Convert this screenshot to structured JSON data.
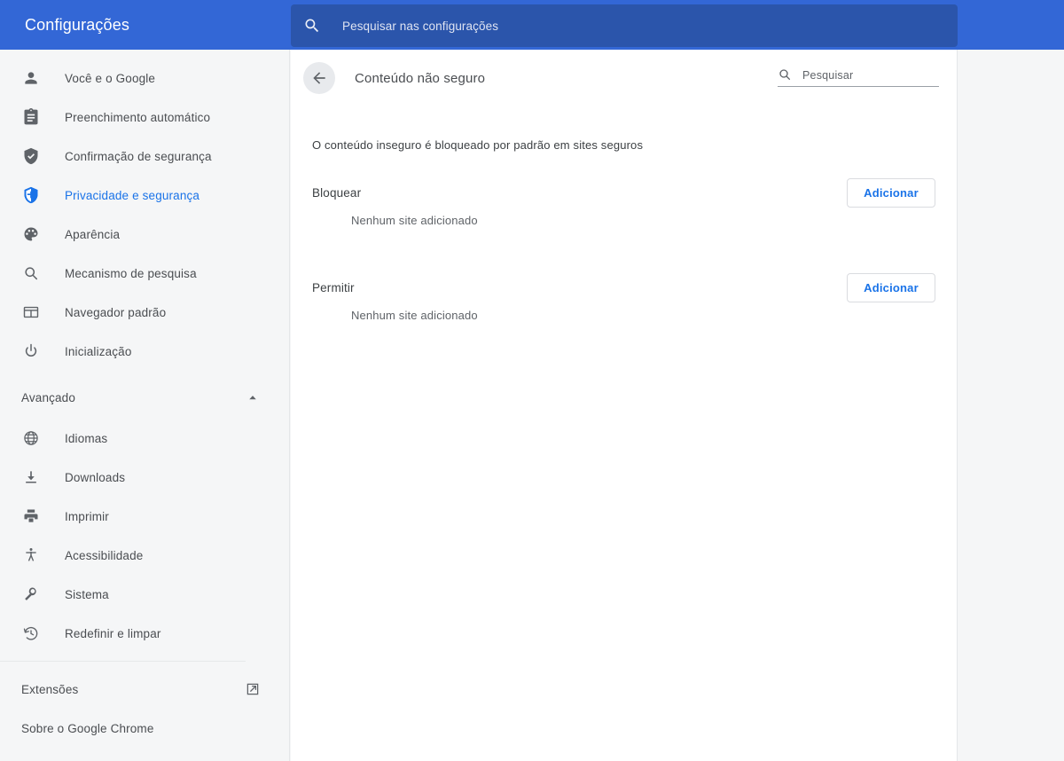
{
  "colors": {
    "header_blue": "#3367d6",
    "search_blue": "#2b55ab",
    "accent_blue": "#1a73e8",
    "sidebar_bg": "#f5f6f7",
    "card_bg": "#ffffff",
    "text_primary": "#3c4043",
    "text_secondary": "#5f6368",
    "divider": "#e4e6e9"
  },
  "topbar": {
    "title": "Configurações",
    "search_icon": "search-icon",
    "search_placeholder": "Pesquisar nas configurações",
    "search_value": ""
  },
  "sidebar": {
    "items": [
      {
        "label": "Você e o Google",
        "icon": "person-icon",
        "selected": false
      },
      {
        "label": "Preenchimento automático",
        "icon": "clipboard-icon",
        "selected": false
      },
      {
        "label": "Confirmação de segurança",
        "icon": "shield-check-icon",
        "selected": false
      },
      {
        "label": "Privacidade e segurança",
        "icon": "shield-icon",
        "selected": true
      },
      {
        "label": "Aparência",
        "icon": "palette-icon",
        "selected": false
      },
      {
        "label": "Mecanismo de pesquisa",
        "icon": "search-icon",
        "selected": false
      },
      {
        "label": "Navegador padrão",
        "icon": "browser-window-icon",
        "selected": false
      },
      {
        "label": "Inicialização",
        "icon": "power-icon",
        "selected": false
      }
    ],
    "advanced_section": {
      "label": "Avançado",
      "chevron_icon": "chevron-up-icon",
      "expanded": true,
      "items": [
        {
          "label": "Idiomas",
          "icon": "globe-icon"
        },
        {
          "label": "Downloads",
          "icon": "download-icon"
        },
        {
          "label": "Imprimir",
          "icon": "printer-icon"
        },
        {
          "label": "Acessibilidade",
          "icon": "accessibility-icon"
        },
        {
          "label": "Sistema",
          "icon": "wrench-icon"
        },
        {
          "label": "Redefinir e limpar",
          "icon": "restore-history-icon"
        }
      ]
    },
    "footer_items": [
      {
        "label": "Extensões",
        "trailing_icon": "external-link-icon"
      },
      {
        "label": "Sobre o Google Chrome",
        "trailing_icon": ""
      }
    ]
  },
  "main": {
    "back_icon": "arrow-back-icon",
    "title": "Conteúdo não seguro",
    "search_icon": "search-icon",
    "search_placeholder": "Pesquisar",
    "search_value": "",
    "description": "O conteúdo inseguro é bloqueado por padrão em sites seguros",
    "sections": [
      {
        "title": "Bloquear",
        "add_label": "Adicionar",
        "empty_label": "Nenhum site adicionado",
        "sites": []
      },
      {
        "title": "Permitir",
        "add_label": "Adicionar",
        "empty_label": "Nenhum site adicionado",
        "sites": []
      }
    ]
  }
}
